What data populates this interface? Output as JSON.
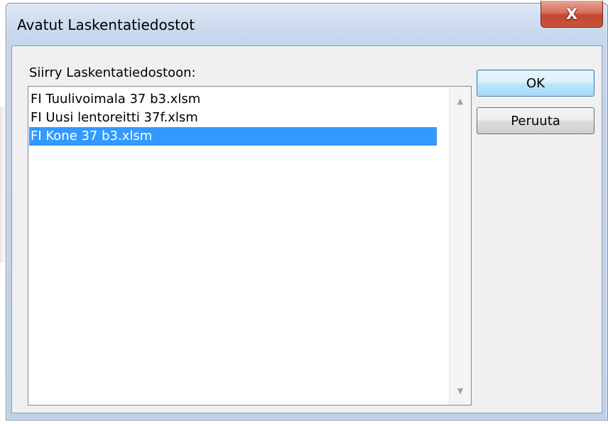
{
  "window": {
    "title": "Avatut Laskentatiedostot",
    "close_glyph": "X"
  },
  "list": {
    "label": "Siirry Laskentatiedostoon:",
    "items": [
      {
        "label": "FI Tuulivoimala 37 b3.xlsm",
        "selected": false
      },
      {
        "label": "FI Uusi lentoreitti 37f.xlsm",
        "selected": false
      },
      {
        "label": "FI Kone 37 b3.xlsm",
        "selected": true
      }
    ],
    "scroll_up_glyph": "▲",
    "scroll_down_glyph": "▼"
  },
  "buttons": {
    "ok_label": "OK",
    "cancel_label": "Peruuta"
  },
  "colors": {
    "selection": "#3399ff",
    "close_button": "#c6452f",
    "title_bar": "#cddcee"
  }
}
